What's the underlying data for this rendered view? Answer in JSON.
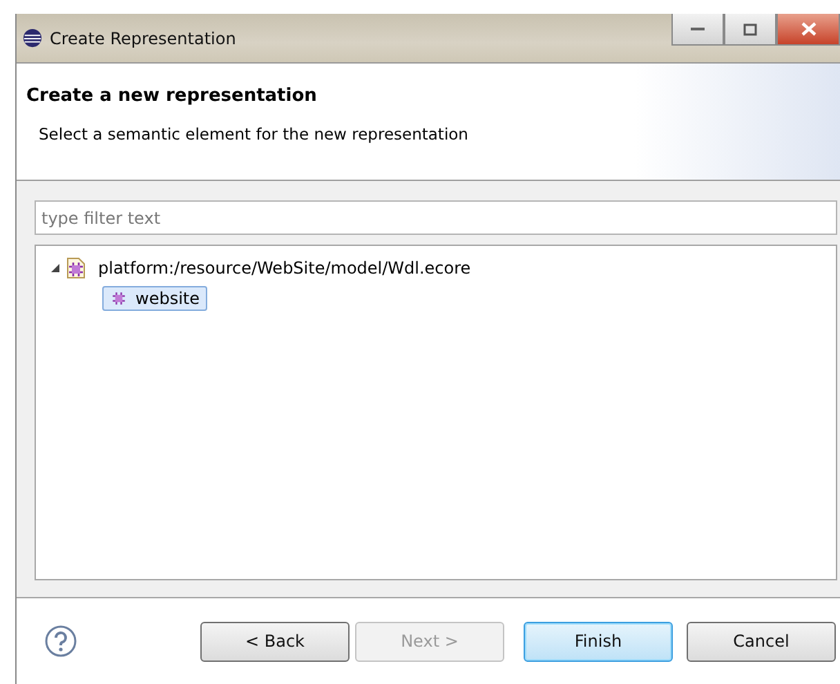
{
  "window": {
    "title": "Create Representation"
  },
  "header": {
    "title": "Create a new representation",
    "message": "Select a semantic element for the new representation"
  },
  "filter": {
    "placeholder": "type filter text"
  },
  "tree": [
    {
      "label": "platform:/resource/WebSite/model/Wdl.ecore",
      "kind": "file",
      "expanded": true,
      "selected": false,
      "children": [
        {
          "label": "website",
          "kind": "package",
          "selected": true
        }
      ]
    }
  ],
  "buttons": [
    {
      "label": "< Back",
      "disabled": false,
      "default": false
    },
    {
      "label": "Next >",
      "disabled": true,
      "default": false
    },
    {
      "label": "Finish",
      "disabled": false,
      "default": true
    },
    {
      "label": "Cancel",
      "disabled": false,
      "default": false
    }
  ]
}
